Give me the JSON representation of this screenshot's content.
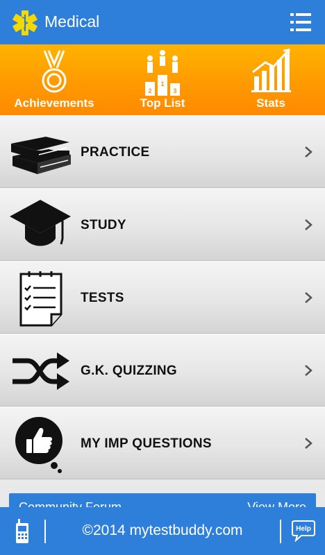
{
  "appbar": {
    "title": "Medical",
    "logo_icon": "star-of-life-icon",
    "menu_icon": "list-menu-icon"
  },
  "stats": [
    {
      "label": "Achievements",
      "icon": "medal-icon"
    },
    {
      "label": "Top List",
      "icon": "podium-icon"
    },
    {
      "label": "Stats",
      "icon": "bar-chart-icon"
    }
  ],
  "menu": [
    {
      "label": "PRACTICE",
      "icon": "books-icon"
    },
    {
      "label": "STUDY",
      "icon": "graduation-cap-icon"
    },
    {
      "label": "TESTS",
      "icon": "checklist-icon"
    },
    {
      "label": "G.K. QUIZZING",
      "icon": "shuffle-icon"
    },
    {
      "label": "MY IMP QUESTIONS",
      "icon": "thumbs-up-bubble-icon"
    }
  ],
  "forum": {
    "title": "Community Forum",
    "more": "View More"
  },
  "footer": {
    "copyright": "©2014 mytestbuddy.com",
    "help": "Help"
  },
  "colors": {
    "primary": "#2e7fd9",
    "accent": "#ff9800"
  }
}
